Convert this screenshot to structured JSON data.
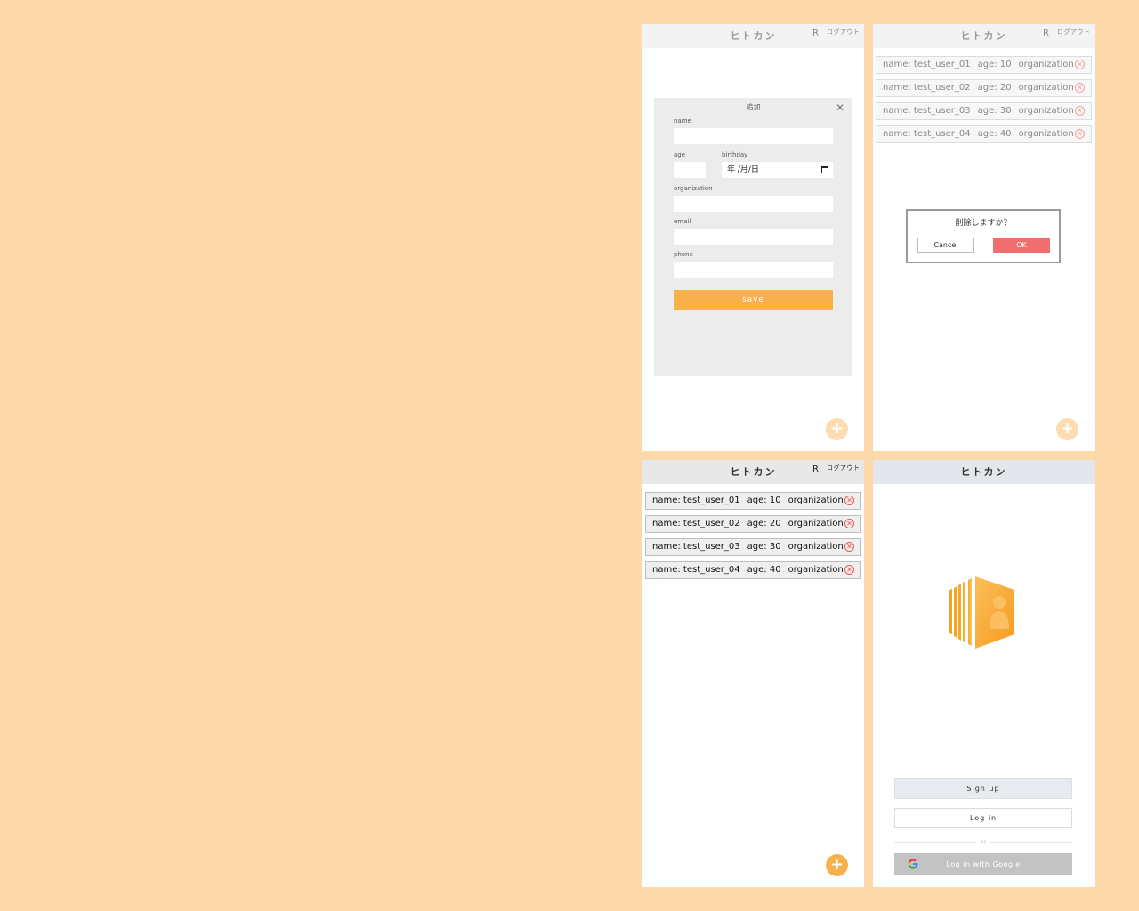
{
  "app": {
    "title": "ヒトカン",
    "user_initial": "R",
    "logout_label": "ログアウト"
  },
  "add_modal": {
    "title": "追加",
    "close_glyph": "✕",
    "fields": {
      "name_label": "name",
      "age_label": "age",
      "birthday_label": "birthday",
      "birthday_value": "年 /月/日",
      "organization_label": "organization",
      "email_label": "email",
      "phone_label": "phone"
    },
    "save_label": "save"
  },
  "users": [
    {
      "name": "name: test_user_01",
      "age": "age: 10",
      "org": "organization"
    },
    {
      "name": "name: test_user_02",
      "age": "age: 20",
      "org": "organization"
    },
    {
      "name": "name: test_user_03",
      "age": "age: 30",
      "org": "organization"
    },
    {
      "name": "name: test_user_04",
      "age": "age: 40",
      "org": "organization"
    }
  ],
  "delete_dialog": {
    "message": "削除しますか？",
    "cancel_label": "Cancel",
    "ok_label": "OK"
  },
  "landing": {
    "signup_label": "Sign up",
    "login_label": "Log in",
    "divider_text": "or",
    "google_label": "Log in with Google"
  },
  "fab_glyph": "+",
  "remove_glyph": "✕",
  "colors": {
    "background": "#fdd9a9",
    "accent": "#f8b04b",
    "danger": "#ef6e6e",
    "header": "#f3f3f3"
  }
}
